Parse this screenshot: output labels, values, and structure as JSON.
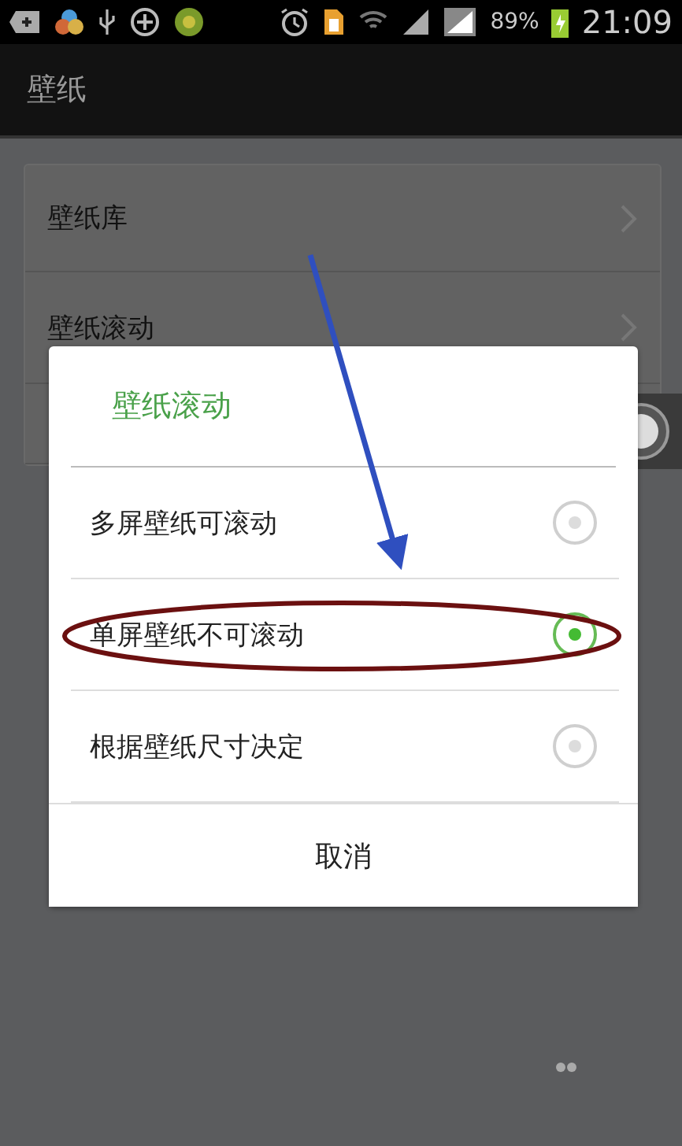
{
  "status_bar": {
    "battery": "89%",
    "time": "21:09"
  },
  "title": "壁纸",
  "settings": [
    {
      "label": "壁纸库"
    },
    {
      "label": "壁纸滚动"
    }
  ],
  "dialog": {
    "title": "壁纸滚动",
    "options": [
      {
        "label": "多屏壁纸可滚动",
        "selected": false
      },
      {
        "label": "单屏壁纸不可滚动",
        "selected": true
      },
      {
        "label": "根据壁纸尺寸决定",
        "selected": false
      }
    ],
    "cancel": "取消"
  }
}
